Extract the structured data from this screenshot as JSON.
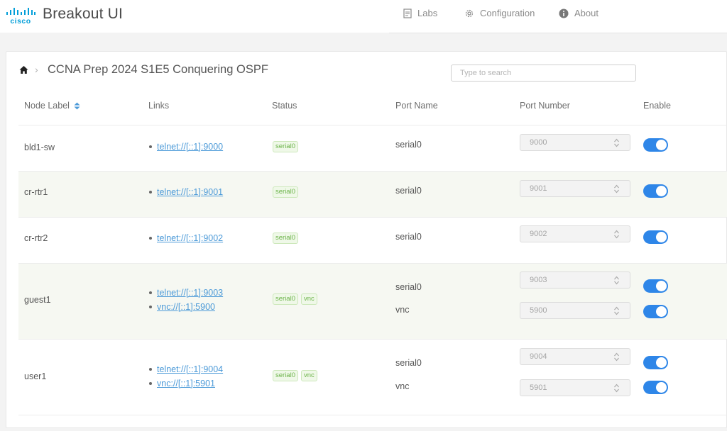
{
  "header": {
    "brand_text": "cisco",
    "app_title": "Breakout UI",
    "nav": [
      {
        "label": "Labs",
        "icon": "document-icon"
      },
      {
        "label": "Configuration",
        "icon": "gear-icon"
      },
      {
        "label": "About",
        "icon": "info-icon"
      }
    ]
  },
  "breadcrumb": {
    "home_icon": "home-icon",
    "page_title": "CCNA Prep 2024 S1E5 Conquering OSPF"
  },
  "search": {
    "placeholder": "Type to search",
    "value": ""
  },
  "table": {
    "columns": [
      "Node Label",
      "Links",
      "Status",
      "Port Name",
      "Port Number",
      "Enable"
    ],
    "sort_column": "Node Label",
    "rows": [
      {
        "label": "bld1-sw",
        "links": [
          "telnet://[::1]:9000"
        ],
        "status": [
          "serial0"
        ],
        "ports": [
          {
            "name": "serial0",
            "number": "9000",
            "enabled": true
          }
        ]
      },
      {
        "label": "cr-rtr1",
        "links": [
          "telnet://[::1]:9001"
        ],
        "status": [
          "serial0"
        ],
        "ports": [
          {
            "name": "serial0",
            "number": "9001",
            "enabled": true
          }
        ]
      },
      {
        "label": "cr-rtr2",
        "links": [
          "telnet://[::1]:9002"
        ],
        "status": [
          "serial0"
        ],
        "ports": [
          {
            "name": "serial0",
            "number": "9002",
            "enabled": true
          }
        ]
      },
      {
        "label": "guest1",
        "links": [
          "telnet://[::1]:9003",
          "vnc://[::1]:5900"
        ],
        "status": [
          "serial0",
          "vnc"
        ],
        "ports": [
          {
            "name": "serial0",
            "number": "9003",
            "enabled": true
          },
          {
            "name": "vnc",
            "number": "5900",
            "enabled": true
          }
        ]
      },
      {
        "label": "user1",
        "links": [
          "telnet://[::1]:9004",
          "vnc://[::1]:5901"
        ],
        "status": [
          "serial0",
          "vnc"
        ],
        "ports": [
          {
            "name": "serial0",
            "number": "9004",
            "enabled": true
          },
          {
            "name": "vnc",
            "number": "5901",
            "enabled": true
          }
        ]
      }
    ]
  },
  "colors": {
    "accent": "#2e86e8",
    "link": "#4c9ad8",
    "cisco_blue": "#049fd9",
    "badge_green": "#6bb349",
    "alt_row": "#f6f8f2"
  }
}
